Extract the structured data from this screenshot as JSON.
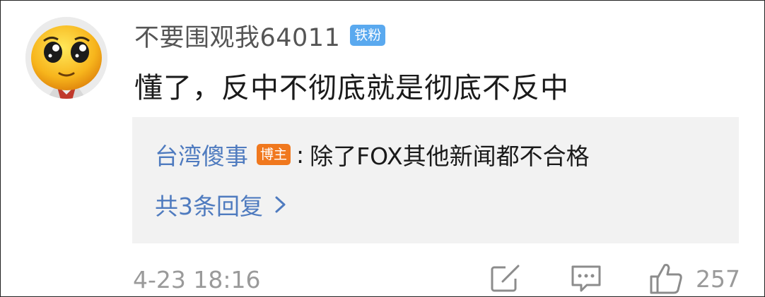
{
  "comment": {
    "username": "不要围观我64011",
    "user_badge": "铁粉",
    "text": "懂了，反中不彻底就是彻底不反中"
  },
  "reply_preview": {
    "author": "台湾傻事",
    "author_badge": "博主",
    "colon": ":",
    "text": "除了FOX其他新闻都不合格",
    "more_label": "共3条回复"
  },
  "footer": {
    "timestamp": "4-23 18:16",
    "like_count": "257"
  },
  "icons": {
    "avatar": "emoji-face-avatar",
    "chevron": "chevron-right-icon",
    "share": "edit-share-icon",
    "comment": "comment-bubble-icon",
    "like": "thumbs-up-icon"
  },
  "colors": {
    "fan_badge": "#5aa9ef",
    "blogger_badge": "#f0781e",
    "link_blue": "#4f7bbf"
  }
}
